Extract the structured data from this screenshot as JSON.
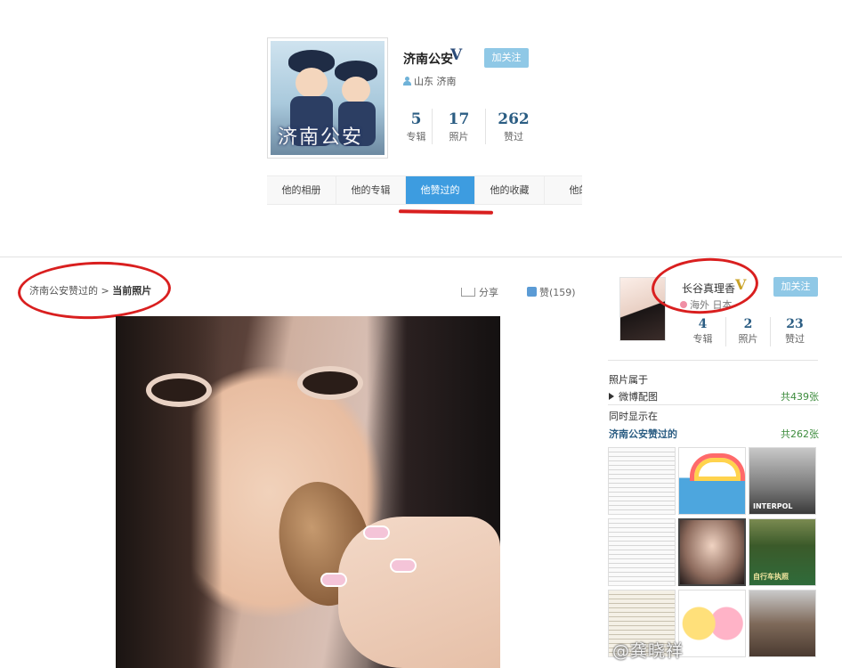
{
  "profile": {
    "name": "济南公安",
    "verified_mark": "V",
    "follow_label": "加关注",
    "location": "山东 济南",
    "avatar_text": "济南公安",
    "stats": [
      {
        "value": "5",
        "label": "专辑"
      },
      {
        "value": "17",
        "label": "照片"
      },
      {
        "value": "262",
        "label": "赞过"
      }
    ],
    "tabs": [
      {
        "label": "他的相册",
        "active": false
      },
      {
        "label": "他的专辑",
        "active": false
      },
      {
        "label": "他赞过的",
        "active": true
      },
      {
        "label": "他的收藏",
        "active": false
      },
      {
        "label": "他的",
        "active": false
      }
    ]
  },
  "photo_page": {
    "breadcrumb_parent": "济南公安赞过的",
    "breadcrumb_sep": ">",
    "breadcrumb_current": "当前照片",
    "share_label": "分享",
    "like_label": "赞(159)"
  },
  "sidebar": {
    "owner": {
      "name": "长谷真理香",
      "verified_mark": "V",
      "follow_label": "加关注",
      "location": "海外 日本",
      "stats": [
        {
          "value": "4",
          "label": "专辑"
        },
        {
          "value": "2",
          "label": "照片"
        },
        {
          "value": "23",
          "label": "赞过"
        }
      ]
    },
    "belongs_to_label": "照片属于",
    "album_name": "微博配图",
    "album_count": "共439张",
    "also_shown_label": "同时显示在",
    "liked_by_name": "济南公安赞过的",
    "liked_by_count": "共262张",
    "thumb_captions": [
      "INTERPOL",
      "自行车执照"
    ]
  },
  "watermark": "@龚晓祥",
  "colors": {
    "accent_blue": "#3d9ce0",
    "follow_button": "#8fc8e6",
    "annotation_red": "#d91f1f",
    "count_green": "#3d8c3d"
  }
}
